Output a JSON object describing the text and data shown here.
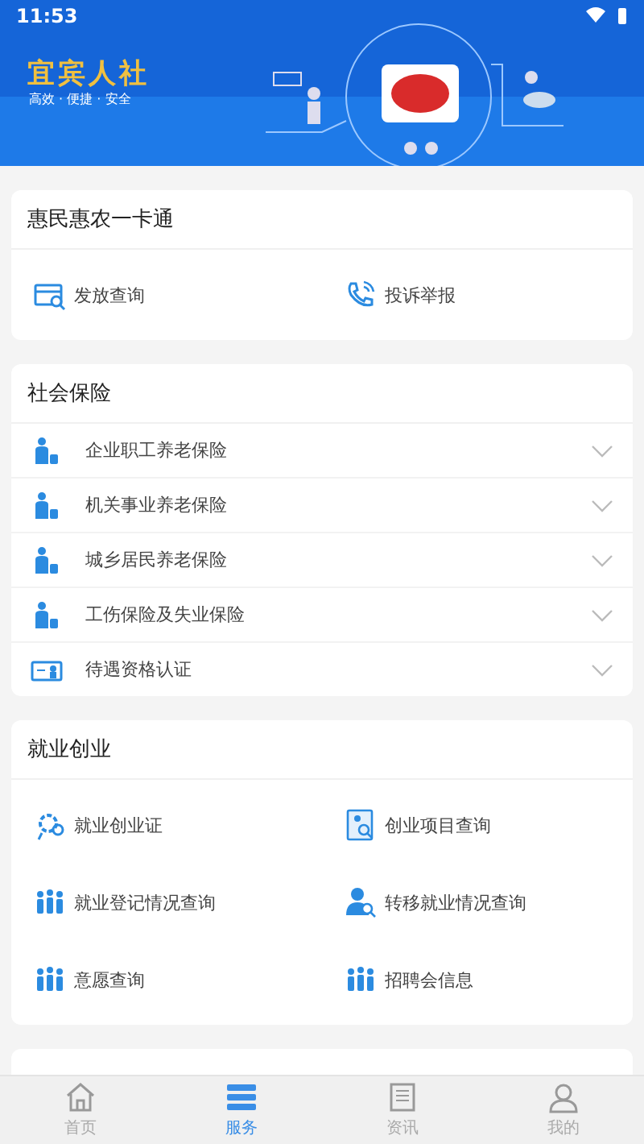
{
  "status_bar": {
    "time": "11:53"
  },
  "banner": {
    "title": "宜宾人社",
    "slogan": "高效 · 便捷 · 安全"
  },
  "sections": [
    {
      "kind": "grid",
      "title": "惠民惠农一卡通",
      "items": [
        {
          "label": "发放查询"
        },
        {
          "label": "投诉举报"
        }
      ]
    },
    {
      "kind": "list",
      "title": "社会保险",
      "items": [
        {
          "label": "企业职工养老保险",
          "expanded": false
        },
        {
          "label": "机关事业养老保险",
          "expanded": false
        },
        {
          "label": "城乡居民养老保险",
          "expanded": false
        },
        {
          "label": "工伤保险及失业保险",
          "expanded": false
        },
        {
          "label": "待遇资格认证",
          "expanded": false
        }
      ]
    },
    {
      "kind": "grid",
      "title": "就业创业",
      "items": [
        {
          "label": "就业创业证"
        },
        {
          "label": "创业项目查询"
        },
        {
          "label": "就业登记情况查询"
        },
        {
          "label": "转移就业情况查询"
        },
        {
          "label": "意愿查询"
        },
        {
          "label": "招聘会信息"
        }
      ]
    },
    {
      "kind": "peek"
    }
  ],
  "tabs": [
    {
      "label": "首页",
      "selected": false
    },
    {
      "label": "服务",
      "selected": true
    },
    {
      "label": "资讯",
      "selected": false
    },
    {
      "label": "我的",
      "selected": false
    }
  ]
}
